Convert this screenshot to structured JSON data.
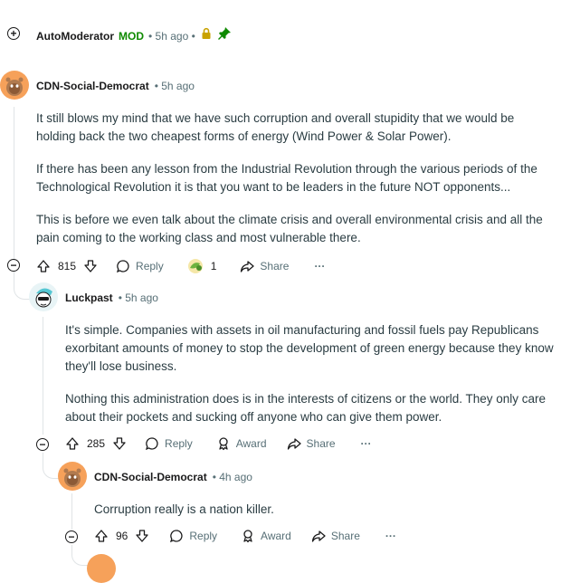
{
  "comment0": {
    "user": "AutoModerator",
    "mod_badge": "MOD",
    "time": "• 5h ago •"
  },
  "comment1": {
    "user": "CDN-Social-Democrat",
    "time": "• 5h ago",
    "paragraphs": [
      "It still blows my mind that we have such corruption and overall stupidity that we would be holding back the two cheapest forms of energy (Wind Power & Solar Power).",
      "If there has been any lesson from the Industrial Revolution through the various periods of the Technological Revolution it is that you want to be leaders in the future NOT opponents...",
      "This is before we even talk about the climate crisis and overall environmental crisis and all the pain coming to the working class and most vulnerable there."
    ],
    "votes": "815",
    "reply": "Reply",
    "award_count": "1",
    "share": "Share",
    "more": "···"
  },
  "comment2": {
    "user": "Luckpast",
    "time": "• 5h ago",
    "paragraphs": [
      "It's simple. Companies with assets in oil manufacturing and fossil fuels pay Republicans exorbitant amounts of money to stop the development of green energy because they know they'll lose business.",
      "Nothing this administration does is in the interests of citizens or the world. They only care about their pockets and sucking off anyone who can give them power."
    ],
    "votes": "285",
    "reply": "Reply",
    "award": "Award",
    "share": "Share",
    "more": "···"
  },
  "comment3": {
    "user": "CDN-Social-Democrat",
    "time": "• 4h ago",
    "paragraphs": [
      "Corruption really is a nation killer."
    ],
    "votes": "96",
    "reply": "Reply",
    "award": "Award",
    "share": "Share",
    "more": "···"
  },
  "colors": {
    "mod": "#0e8a00",
    "text": "#2a3c42",
    "meta": "#576f76",
    "avatar_orange": "#f6a15a"
  }
}
